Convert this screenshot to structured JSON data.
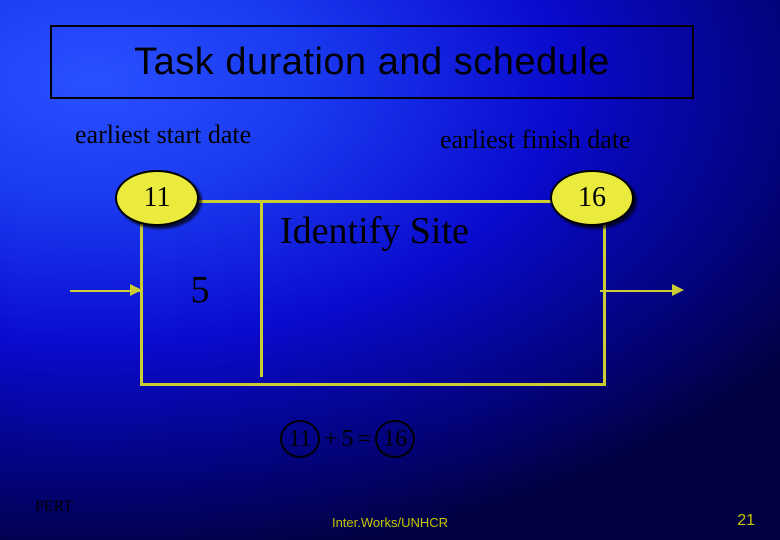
{
  "title": "Task duration and schedule",
  "labels": {
    "earliest_start": "earliest start date",
    "earliest_finish": "earliest finish date"
  },
  "task": {
    "duration": "5",
    "name": "Identify Site"
  },
  "nodes": {
    "es": "11",
    "ef": "16"
  },
  "equation": {
    "a": "11",
    "op1": "+",
    "b": "5",
    "op2": "=",
    "c": "16"
  },
  "footer": {
    "left": "PERT",
    "center": "Inter.Works/UNHCR",
    "right": "21"
  }
}
